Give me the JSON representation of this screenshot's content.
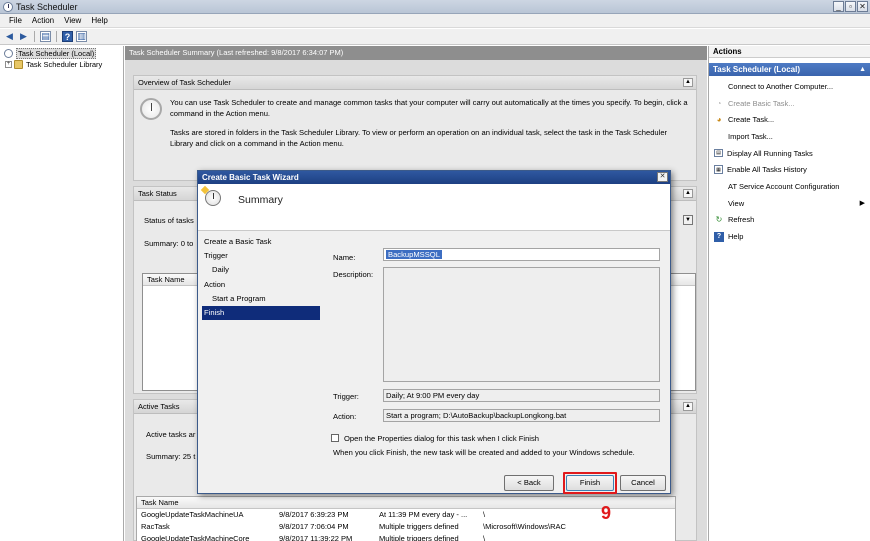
{
  "window": {
    "title": "Task Scheduler"
  },
  "menu": [
    "File",
    "Action",
    "View",
    "Help"
  ],
  "tree": [
    {
      "label": "Task Scheduler (Local)",
      "selected": true
    },
    {
      "label": "Task Scheduler Library",
      "selected": false
    }
  ],
  "center": {
    "header": "Task Scheduler Summary (Last refreshed: 9/8/2017 6:34:07 PM)",
    "overview": {
      "title": "Overview of Task Scheduler",
      "para1": "You can use Task Scheduler to create and manage common tasks that your computer will carry out automatically at the times you specify. To begin, click a command in the Action menu.",
      "para2": "Tasks are stored in folders in the Task Scheduler Library. To view or perform an operation on an individual task, select the task in the Task Scheduler Library and click on a command in the Action menu."
    },
    "task_status": {
      "title": "Task Status",
      "status_of_tasks": "Status of tasks",
      "summary": "Summary: 0 to",
      "column": "Task Name"
    },
    "active_tasks": {
      "title": "Active Tasks",
      "desc": "Active tasks ar",
      "summary": "Summary: 25 t",
      "columns": [
        "Task Name",
        "",
        "",
        ""
      ],
      "rows": [
        [
          "GoogleUpdateTaskMachineUA",
          "9/8/2017 6:39:23 PM",
          "At 11:39 PM every day - ...",
          "\\"
        ],
        [
          "RacTask",
          "9/8/2017 7:06:04 PM",
          "Multiple triggers defined",
          "\\Microsoft\\Windows\\RAC"
        ],
        [
          "GoogleUpdateTaskMachineCore",
          "9/8/2017 11:39:22 PM",
          "Multiple triggers defined",
          "\\"
        ]
      ]
    }
  },
  "actions": {
    "title": "Actions",
    "group": "Task Scheduler (Local)",
    "items": [
      {
        "label": "Connect to Another Computer...",
        "icon": "none",
        "disabled": false
      },
      {
        "label": "Create Basic Task...",
        "icon": "create-basic-task-icon",
        "disabled": true
      },
      {
        "label": "Create Task...",
        "icon": "create-task-icon",
        "disabled": false
      },
      {
        "label": "Import Task...",
        "icon": "none",
        "disabled": false
      },
      {
        "label": "Display All Running Tasks",
        "icon": "running-tasks-icon",
        "disabled": false
      },
      {
        "label": "Enable All Tasks History",
        "icon": "history-icon",
        "disabled": false
      },
      {
        "label": "AT Service Account Configuration",
        "icon": "none",
        "disabled": false
      },
      {
        "label": "View",
        "icon": "none",
        "disabled": false,
        "submenu": true
      },
      {
        "label": "Refresh",
        "icon": "refresh-icon",
        "disabled": false
      },
      {
        "label": "Help",
        "icon": "help-icon",
        "disabled": false
      }
    ]
  },
  "wizard": {
    "title": "Create Basic Task Wizard",
    "heading": "Summary",
    "steps": [
      {
        "label": "Create a Basic Task",
        "indent": false,
        "active": false
      },
      {
        "label": "Trigger",
        "indent": false,
        "active": false
      },
      {
        "label": "Daily",
        "indent": true,
        "active": false
      },
      {
        "label": "Action",
        "indent": false,
        "active": false
      },
      {
        "label": "Start a Program",
        "indent": true,
        "active": false
      },
      {
        "label": "Finish",
        "indent": false,
        "active": true
      }
    ],
    "name_label": "Name:",
    "name_value": "BackupMSSQL",
    "description_label": "Description:",
    "description_value": "",
    "trigger_label": "Trigger:",
    "trigger_value": "Daily; At 9:00 PM every day",
    "action_label": "Action:",
    "action_value": "Start a program; D:\\AutoBackup\\backupLongkong.bat",
    "checkbox_label": "Open the Properties dialog for this task when I click Finish",
    "checkbox_checked": false,
    "note": "When you click Finish, the new task will be created and added to your Windows schedule.",
    "buttons": {
      "back": "< Back",
      "finish": "Finish",
      "cancel": "Cancel"
    }
  },
  "annotation": {
    "step_number": "9",
    "color": "#e0191b"
  },
  "colors": {
    "accent": "#1d3f82",
    "selection": "#0f2c7a",
    "highlight": "#e0191b"
  }
}
